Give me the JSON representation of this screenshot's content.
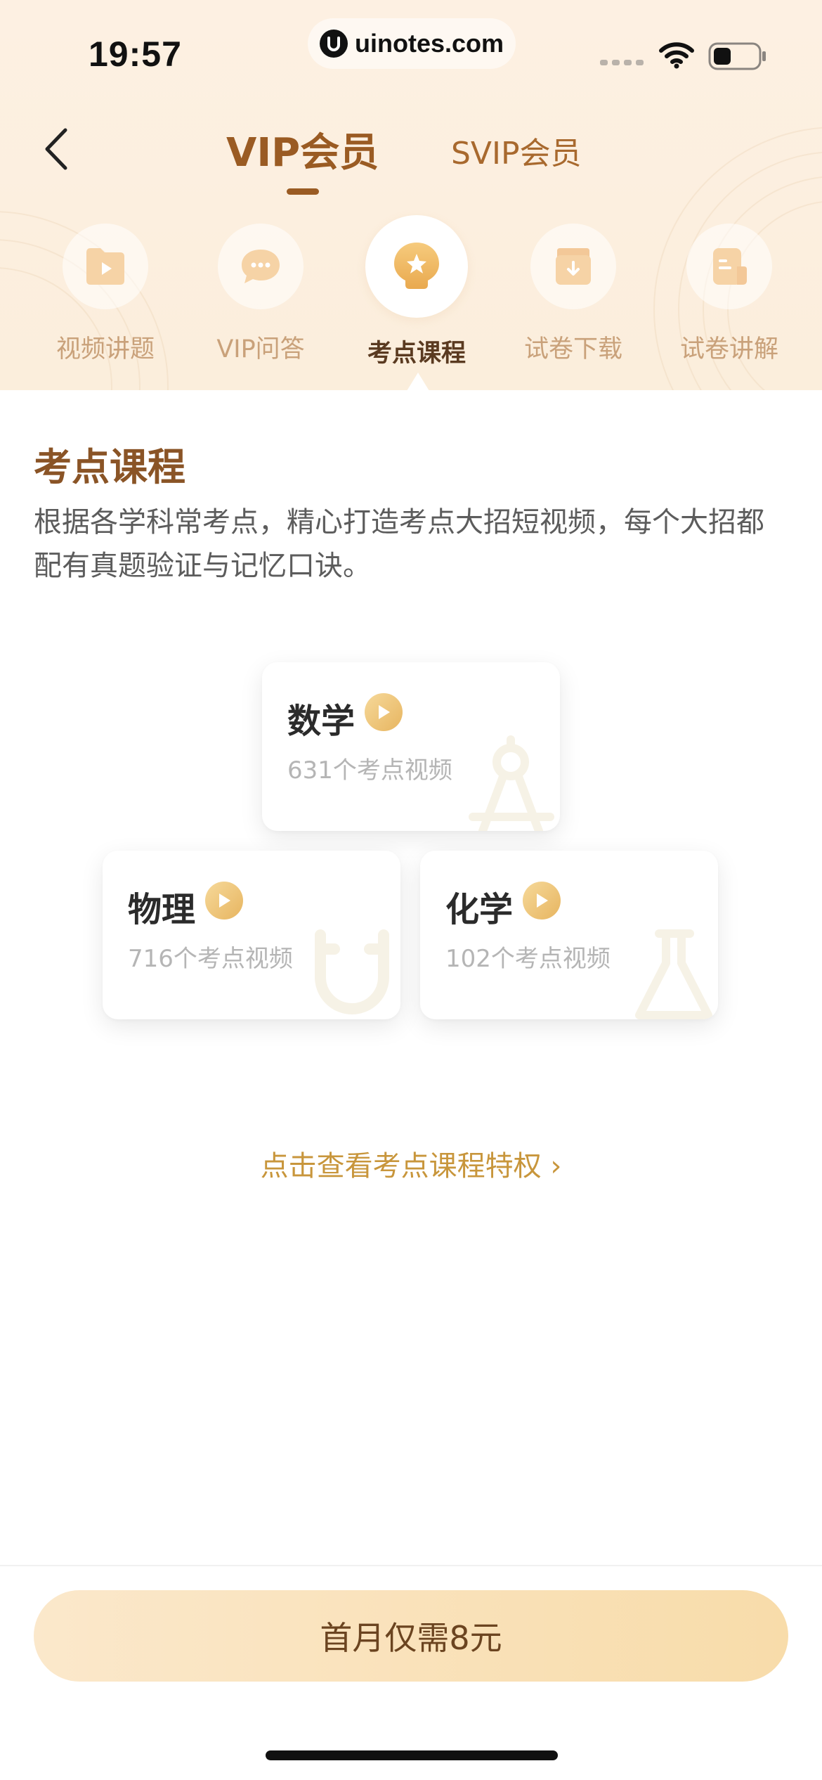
{
  "status_bar": {
    "time": "19:57",
    "url": "uinotes.com"
  },
  "nav": {
    "back_icon": "chevron-left-icon",
    "tabs": [
      {
        "label": "VIP会员",
        "active": true
      },
      {
        "label": "SVIP会员",
        "active": false
      }
    ]
  },
  "features": [
    {
      "label": "视频讲题",
      "icon": "video-folder-icon",
      "active": false
    },
    {
      "label": "VIP问答",
      "icon": "chat-bubble-icon",
      "active": false
    },
    {
      "label": "考点课程",
      "icon": "star-bulb-icon",
      "active": true
    },
    {
      "label": "试卷下载",
      "icon": "download-box-icon",
      "active": false
    },
    {
      "label": "试卷讲解",
      "icon": "document-icon",
      "active": false
    }
  ],
  "section": {
    "title": "考点课程",
    "description": "根据各学科常考点，精心打造考点大招短视频，每个大招都配有真题验证与记忆口诀。"
  },
  "subjects": [
    {
      "name": "数学",
      "count_text": "631个考点视频",
      "watermark_icon": "compass-icon"
    },
    {
      "name": "物理",
      "count_text": "716个考点视频",
      "watermark_icon": "magnet-icon"
    },
    {
      "name": "化学",
      "count_text": "102个考点视频",
      "watermark_icon": "flask-icon"
    }
  ],
  "privilege_link": "点击查看考点课程特权 ›",
  "cta": {
    "label": "首月仅需8元"
  },
  "colors": {
    "accent_brown": "#9a5b23",
    "gold": "#c8963c",
    "cta_gradient_start": "#fbe8cb",
    "cta_gradient_end": "#f8dcaa"
  }
}
